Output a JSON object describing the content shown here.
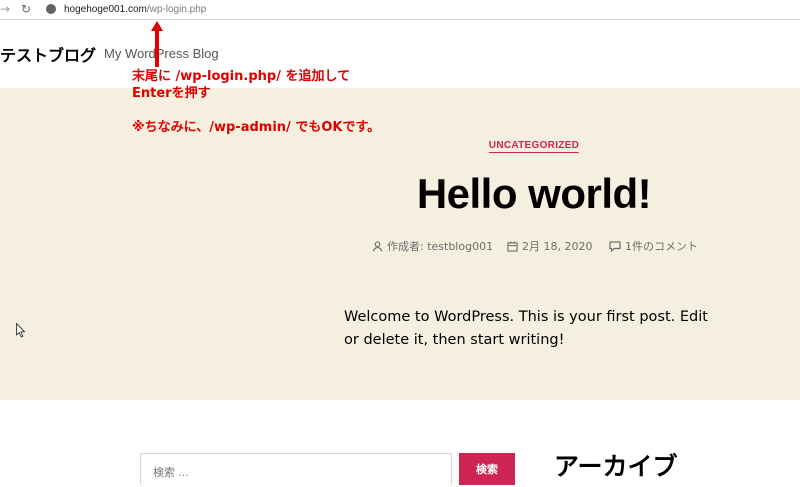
{
  "browser": {
    "url_host": "hogehoge001.com",
    "url_path": "/wp-login.php"
  },
  "header": {
    "site_title": "テストブログ",
    "site_description": "My WordPress Blog"
  },
  "annotation": {
    "line1": "末尾に /wp-login.php/ を追加して",
    "line2": "Enterを押す",
    "line3": "※ちなみに、/wp-admin/ でもOKです。",
    "color": "#e00000"
  },
  "post": {
    "category": "UNCATEGORIZED",
    "title": "Hello world!",
    "author": "作成者: testblog001",
    "date": "2月 18, 2020",
    "comments": "1件のコメント",
    "body": "Welcome to WordPress. This is your first post. Edit or delete it, then start writing!"
  },
  "sidebar": {
    "search_placeholder": "検索 …",
    "search_button": "検索",
    "archive_heading": "アーカイブ"
  },
  "colors": {
    "accent": "#cd2653",
    "hero_bg": "#f5efe0"
  }
}
